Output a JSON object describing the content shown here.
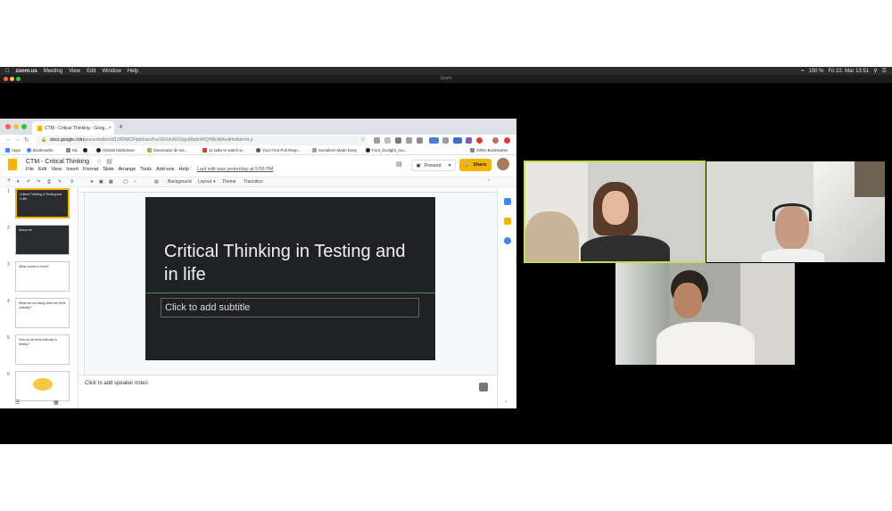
{
  "mac_menubar": {
    "app": "zoom.us",
    "items": [
      "Meeting",
      "View",
      "Edit",
      "Window",
      "Help"
    ],
    "battery": "100 %",
    "clock": "Fri 22. Mar  13:51"
  },
  "zoom_window": {
    "title": "Zoom"
  },
  "browser": {
    "tab_title": "CTM - Critical Thinking - Goog...",
    "url_host": "docs.google.com",
    "url_path": "/presentation/d/1XB9MCPqbbbamPoxSDXdvNX3rguWqdxWfQH8lnA8/edit#slide=id.p",
    "bookmarks": [
      "Apps",
      "Bookmarks",
      "ML",
      "GitHub Markdown",
      "Generador de las...",
      "11 talks to watch w...",
      "Your First Pull Requ...",
      "Socialism Made Easy",
      "Font_boxlight_ma...",
      "Other Bookmarks"
    ]
  },
  "slides_app": {
    "doc_title": "CTM - Critical Thinking",
    "menu": [
      "File",
      "Edit",
      "View",
      "Insert",
      "Format",
      "Slide",
      "Arrange",
      "Tools",
      "Add-ons",
      "Help"
    ],
    "last_edit": "Last edit was yesterday at 9:58 PM",
    "present_label": "Present",
    "share_label": "Share",
    "toolbar": {
      "background": "Background",
      "layout": "Layout",
      "theme": "Theme",
      "transition": "Transition"
    },
    "slide": {
      "title": "Critical Thinking in Testing and in life",
      "subtitle_placeholder": "Click to add subtitle"
    },
    "speaker_notes_placeholder": "Click to add speaker notes",
    "thumbnails": [
      {
        "num": "1",
        "text": "Critical Thinking in Testing and in life",
        "style": "dark"
      },
      {
        "num": "2",
        "text": "About me",
        "style": "dark"
      },
      {
        "num": "3",
        "text": "What comes to mind?",
        "style": "light"
      },
      {
        "num": "4",
        "text": "What are we doing when we think critically?",
        "style": "light"
      },
      {
        "num": "5",
        "text": "How do we think critically in testing?",
        "style": "light"
      },
      {
        "num": "6",
        "text": "",
        "style": "light"
      }
    ]
  },
  "colors": {
    "active_speaker_border": "#c7dc50",
    "share_button": "#f4b400",
    "slide_background": "#202124",
    "slide_accent_line": "#3f8f62"
  }
}
